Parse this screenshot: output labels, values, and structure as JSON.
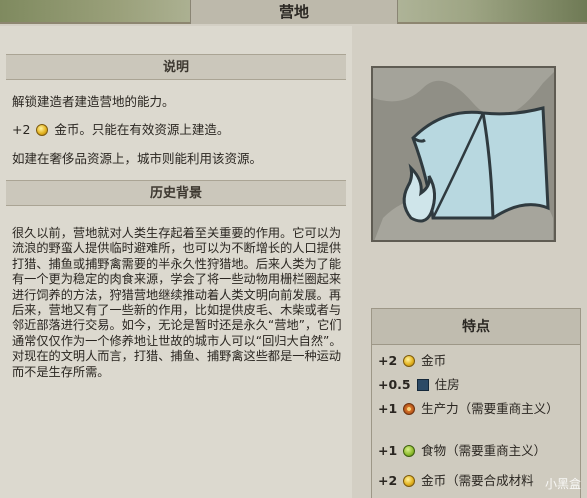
{
  "title": "营地",
  "description": {
    "heading": "说明",
    "line1": "解锁建造者建造营地的能力。",
    "line2_prefix": "+2",
    "line2_suffix": "金币。只能在有效资源上建造。",
    "line3": "如建在奢侈品资源上，城市则能利用该资源。"
  },
  "history": {
    "heading": "历史背景",
    "text": "很久以前，营地就对人类生存起着至关重要的作用。它可以为流浪的野蛮人提供临时避难所，也可以为不断增长的人口提供打猎、捕鱼或捕野禽需要的半永久性狩猎地。后来人类为了能有一个更为稳定的肉食来源，学会了将一些动物用栅栏圈起来进行饲养的方法，狩猎营地继续推动着人类文明向前发展。再后来，营地又有了一些新的作用，比如提供皮毛、木柴或者与邻近部落进行交易。如今，无论是暂时还是永久“营地”，它们通常仅仅作为一个修养地让世故的城市人可以“回归大自然”。对现在的文明人而言，打猎、捕鱼、捕野禽这些都是一种运动而不是生存所需。"
  },
  "traits": {
    "heading": "特点",
    "items": [
      {
        "amount": "+2",
        "icon": "gold-icon",
        "label": "金币"
      },
      {
        "amount": "+0.5",
        "icon": "house-icon",
        "label": "住房"
      },
      {
        "amount": "+1",
        "icon": "production-icon",
        "label": "生产力（需要重商主义）"
      },
      {
        "amount": "+1",
        "icon": "food-icon",
        "label": "食物（需要重商主义）"
      },
      {
        "amount": "+2",
        "icon": "gold-icon",
        "label": "金币（需要合成材料"
      }
    ]
  },
  "watermark": "小黑盒"
}
